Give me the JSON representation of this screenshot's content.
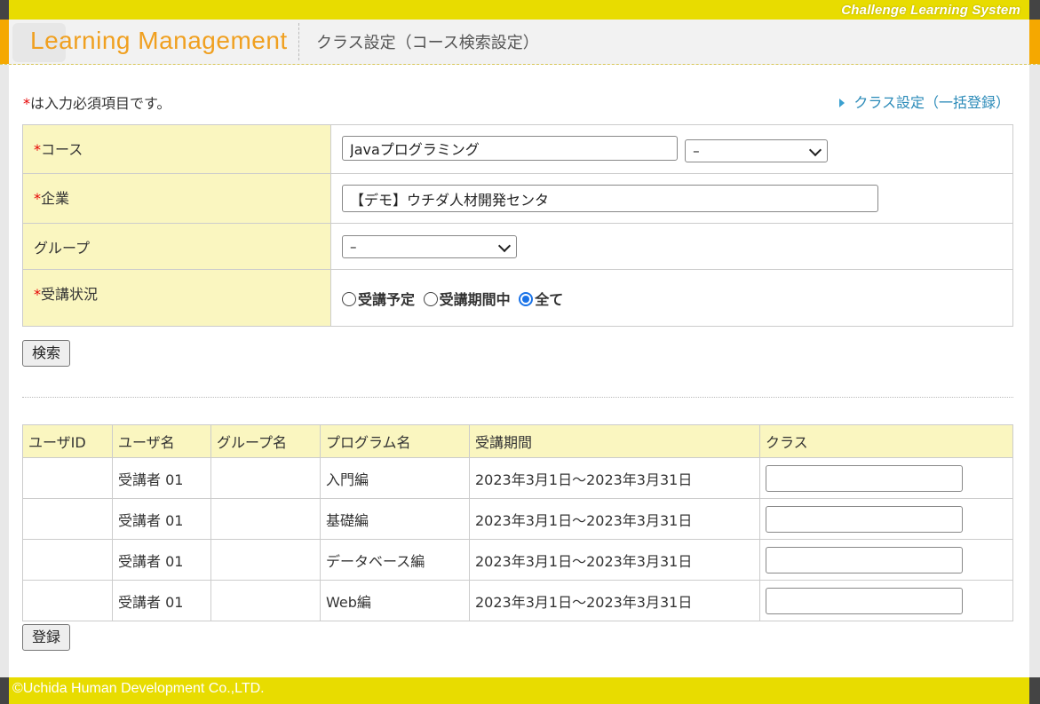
{
  "topbar": {
    "system_name": "Challenge Learning System"
  },
  "header": {
    "logo": "Learning Management",
    "page_title": "クラス設定（コース検索設定）"
  },
  "notice": {
    "star": "*",
    "text": "は入力必須項目です。"
  },
  "bulk_link": "クラス設定（一括登録）",
  "form": {
    "course": {
      "label": "コース",
      "value": "Javaプログラミング",
      "select_value": "–"
    },
    "company": {
      "label": "企業",
      "value": "【デモ】ウチダ人材開発センタ"
    },
    "group": {
      "label": "グループ",
      "select_value": "–"
    },
    "status": {
      "label": "受講状況",
      "options": [
        "受講予定",
        "受講期間中",
        "全て"
      ],
      "selected": "全て"
    }
  },
  "search_button": "検索",
  "table": {
    "headers": [
      "ユーザID",
      "ユーザ名",
      "グループ名",
      "プログラム名",
      "受講期間",
      "クラス"
    ],
    "rows": [
      {
        "user_id": "",
        "user_name": "受講者 01",
        "group": "",
        "program": "入門編",
        "period": "2023年3月1日〜2023年3月31日",
        "class": ""
      },
      {
        "user_id": "",
        "user_name": "受講者 01",
        "group": "",
        "program": "基礎編",
        "period": "2023年3月1日〜2023年3月31日",
        "class": ""
      },
      {
        "user_id": "",
        "user_name": "受講者 01",
        "group": "",
        "program": "データベース編",
        "period": "2023年3月1日〜2023年3月31日",
        "class": ""
      },
      {
        "user_id": "",
        "user_name": "受講者 01",
        "group": "",
        "program": "Web編",
        "period": "2023年3月1日〜2023年3月31日",
        "class": ""
      }
    ]
  },
  "register_button": "登録",
  "footer": {
    "copyright": "©Uchida Human Development Co.,LTD."
  },
  "colors": {
    "yellow": "#e8dc00",
    "orange": "#f5a800",
    "label_bg": "#faf6c0",
    "link": "#2a8ab8",
    "required": "#e60000"
  }
}
